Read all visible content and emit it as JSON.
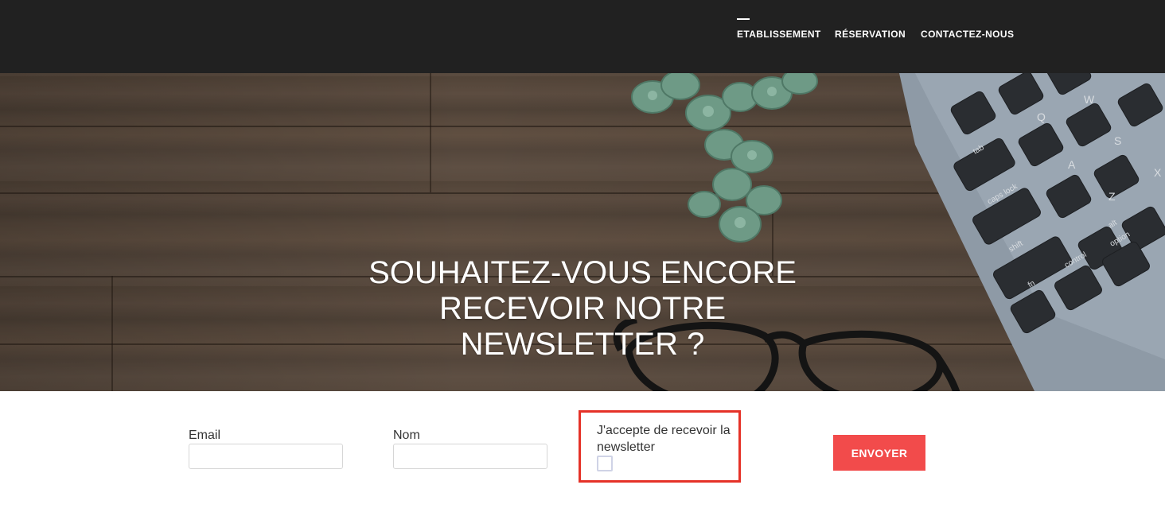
{
  "nav": {
    "items": [
      {
        "label": "ETABLISSEMENT",
        "active": true
      },
      {
        "label": "RÉSERVATION",
        "active": false
      },
      {
        "label": "CONTACTEZ-NOUS",
        "active": false
      }
    ]
  },
  "hero": {
    "title_lines": [
      "SOUHAITEZ-VOUS ENCORE",
      "RECEVOIR NOTRE",
      "NEWSLETTER ?"
    ]
  },
  "form": {
    "email": {
      "label": "Email",
      "value": "",
      "placeholder": ""
    },
    "name": {
      "label": "Nom",
      "value": "",
      "placeholder": ""
    },
    "consent": {
      "label": "J'accepte de recevoir la newsletter",
      "checked": false
    },
    "submit_label": "ENVOYER"
  },
  "colors": {
    "topbar": "#212121",
    "accent": "#f24b4b",
    "highlight_border": "#e53228"
  },
  "keyboard_keys": [
    "tab",
    "caps lock",
    "shift",
    "fn",
    "control",
    "option",
    "alt",
    "Q",
    "W",
    "A",
    "S",
    "Z",
    "X"
  ]
}
